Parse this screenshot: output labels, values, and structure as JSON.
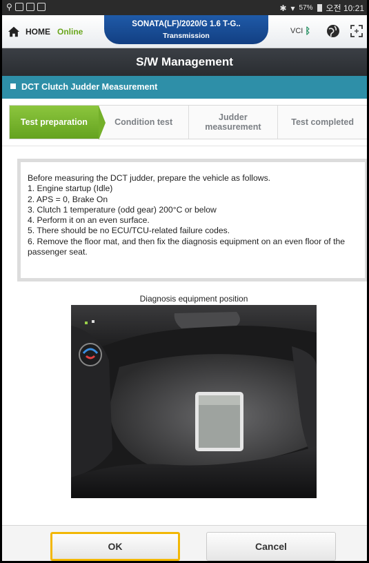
{
  "status_bar": {
    "battery": "57%",
    "time": "오전 10:21"
  },
  "header": {
    "home_label": "HOME",
    "online_label": "Online",
    "vehicle_line1": "SONATA(LF)/2020/G 1.6 T-G..",
    "vehicle_line2": "Transmission",
    "vci_label": "VCI"
  },
  "title": "S/W Management",
  "subtitle": "DCT Clutch Judder Measurement",
  "steps": [
    {
      "label": "Test preparation",
      "active": true
    },
    {
      "label": "Condition test",
      "active": false
    },
    {
      "label": "Judder\nmeasurement",
      "active": false
    },
    {
      "label": "Test completed",
      "active": false
    }
  ],
  "instructions": [
    "Before measuring the DCT judder, prepare the vehicle as follows.",
    "1. Engine startup (Idle)",
    "2. APS = 0, Brake On",
    "3. Clutch 1 temperature (odd gear) 200°C or below",
    "4. Perform it on an even surface.",
    "5. There should be no ECU/TCU-related failure codes.",
    "6. Remove the floor mat, and then fix the diagnosis equipment on an even floor of the passenger seat."
  ],
  "image_caption": "Diagnosis equipment position",
  "buttons": {
    "ok": "OK",
    "cancel": "Cancel"
  },
  "colors": {
    "header_blue": "#1f5aa8",
    "title_dark": "#2f3236",
    "subtitle_teal": "#2e8fa8",
    "step_active_green": "#74b02a",
    "online_green": "#6aa61c",
    "ok_highlight": "#f2b705"
  }
}
